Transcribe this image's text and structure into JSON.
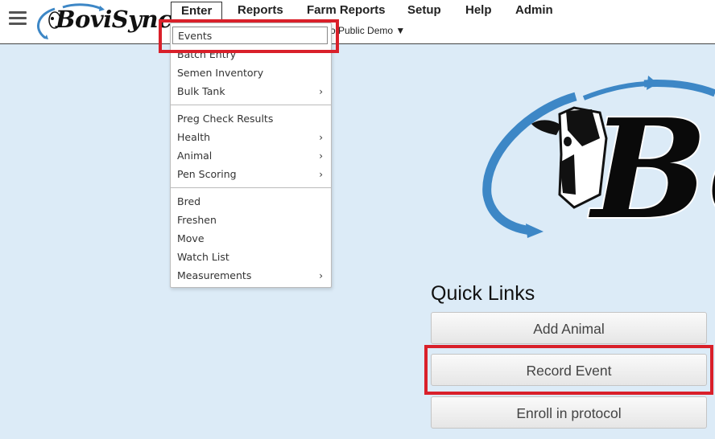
{
  "header": {
    "logo_text": "BoviSync",
    "nav": [
      "Enter",
      "Reports",
      "Farm Reports",
      "Setup",
      "Help",
      "Admin"
    ],
    "farm_selector": "o Public Demo ▼"
  },
  "dropdown": {
    "items": [
      {
        "label": "Events",
        "submenu": false
      },
      {
        "label": "Batch Entry",
        "submenu": false
      },
      {
        "label": "Semen Inventory",
        "submenu": false
      },
      {
        "label": "Bulk Tank",
        "submenu": true
      },
      {
        "label": "Preg Check Results",
        "submenu": false
      },
      {
        "label": "Health",
        "submenu": true
      },
      {
        "label": "Animal",
        "submenu": true
      },
      {
        "label": "Pen Scoring",
        "submenu": true
      },
      {
        "label": "Bred",
        "submenu": false
      },
      {
        "label": "Freshen",
        "submenu": false
      },
      {
        "label": "Move",
        "submenu": false
      },
      {
        "label": "Watch List",
        "submenu": false
      },
      {
        "label": "Measurements",
        "submenu": true
      }
    ],
    "submenu_arrow": "›"
  },
  "quick_links": {
    "title": "Quick Links",
    "buttons": [
      "Add Animal",
      "Record Event",
      "Enroll in protocol"
    ]
  },
  "big_logo_text": "Bo",
  "colors": {
    "background": "#dcebf7",
    "highlight_box": "#d9202a",
    "logo_blue": "#3d87c6"
  }
}
